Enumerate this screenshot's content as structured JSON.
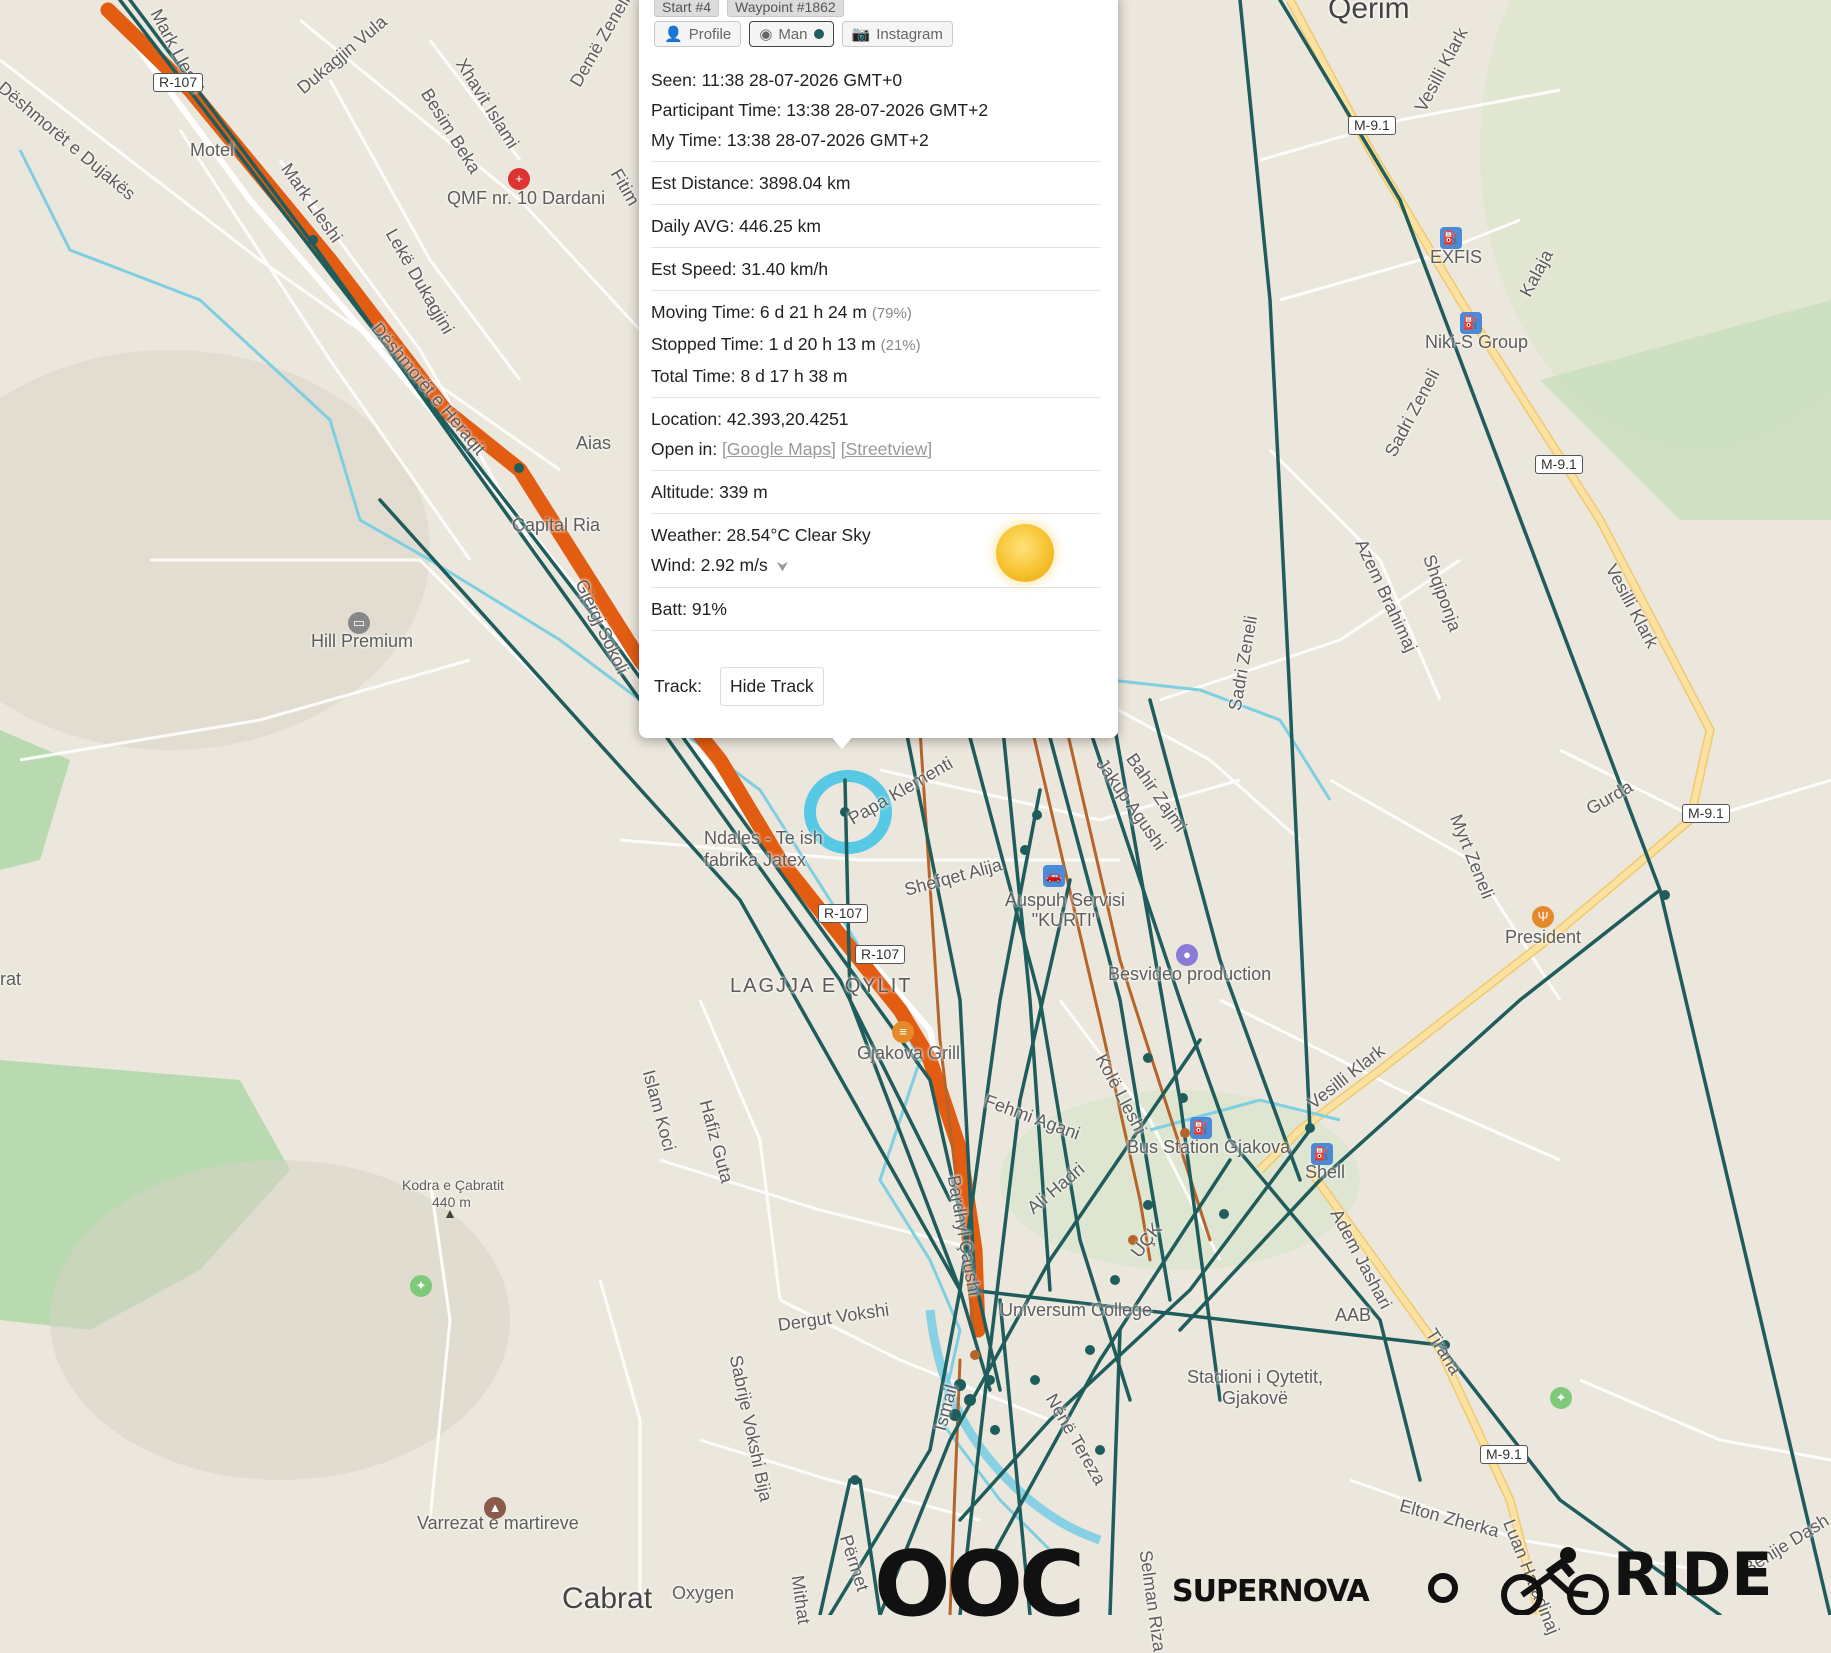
{
  "map": {
    "street_labels": [
      {
        "text": "Dëshmorët e Dujakës"
      },
      {
        "text": "Dukagjin Vula"
      },
      {
        "text": "Xhavit Islami"
      },
      {
        "text": "Besim Beka"
      },
      {
        "text": "Demë Zeneli"
      },
      {
        "text": "Mark Lleshi"
      },
      {
        "text": "Mark Lleshi"
      },
      {
        "text": "Lekë Dukagjini"
      },
      {
        "text": "Dëshmorët e Heraqit"
      },
      {
        "text": "Gjergj Sokoli"
      },
      {
        "text": "Fitim"
      },
      {
        "text": "Papa Klementi"
      },
      {
        "text": "Shefqet Alija"
      },
      {
        "text": "Islam Koci"
      },
      {
        "text": "Hafiz Guta"
      },
      {
        "text": "Fehmi Agani"
      },
      {
        "text": "Ali Hadri"
      },
      {
        "text": "Dergut Vokshi"
      },
      {
        "text": "Sabrije Vokshi Bija"
      },
      {
        "text": "Bardhyl Çaushi"
      },
      {
        "text": "Kolë Lleshi"
      },
      {
        "text": "Jakup Agushi"
      },
      {
        "text": "Bahir Zajmi"
      },
      {
        "text": "Sadri Zeneli"
      },
      {
        "text": "Sadri Zeneli"
      },
      {
        "text": "Azem Brahimaj"
      },
      {
        "text": "Shqiponja"
      },
      {
        "text": "Vesilli Klark"
      },
      {
        "text": "Vesilli Klark"
      },
      {
        "text": "Vesilli Klark"
      },
      {
        "text": "Kalaja"
      },
      {
        "text": "Myrt Zeneli"
      },
      {
        "text": "Gurda"
      },
      {
        "text": "Adem Jashari"
      },
      {
        "text": "Tirana"
      },
      {
        "text": "Elton Zherka"
      },
      {
        "text": "Luan Haradinaj"
      },
      {
        "text": "Behije Dash"
      },
      {
        "text": "Selman Riza"
      },
      {
        "text": "Përmet"
      },
      {
        "text": "Mithat"
      },
      {
        "text": "Ismail"
      },
      {
        "text": "Nënë Tereza"
      },
      {
        "text": "UÇK"
      }
    ],
    "place_labels": [
      {
        "text": "Qerim",
        "kind": "big"
      },
      {
        "text": "LAGJJA E QYLIT",
        "kind": "district"
      },
      {
        "text": "Cabrat",
        "kind": "big"
      },
      {
        "text": "Motel"
      },
      {
        "text": "QMF nr. 10 Dardani"
      },
      {
        "text": "Aias"
      },
      {
        "text": "Capital Ria"
      },
      {
        "text": "Hill Premium"
      },
      {
        "text": "Ndales - Te ish fabrika Jatex"
      },
      {
        "text": "Auspuh Servisi \"KURTI\""
      },
      {
        "text": "Besvideo production"
      },
      {
        "text": "Gjakova Grill"
      },
      {
        "text": "Bus Station Gjakova"
      },
      {
        "text": "Shell"
      },
      {
        "text": "AAB"
      },
      {
        "text": "Universum College"
      },
      {
        "text": "Stadioni i Qytetit, Gjakovë"
      },
      {
        "text": "EXFIS"
      },
      {
        "text": "Niki-S Group"
      },
      {
        "text": "President"
      },
      {
        "text": "Kodra e Çabratit"
      },
      {
        "text": "440 m"
      },
      {
        "text": "Varrezat e martireve"
      },
      {
        "text": "Oxygen"
      },
      {
        "text": "rat"
      }
    ],
    "route_shields": [
      "R-107",
      "R-107",
      "R-107",
      "M-9.1",
      "M-9.1",
      "M-9.1",
      "M-9.1"
    ],
    "colors": {
      "track_orange": "#e25c12",
      "track_teal": "#1f5c5c",
      "track_brown": "#b5652a",
      "river": "#5ac8e0",
      "road_major": "#f4d488",
      "green_area": "#b9dab0"
    }
  },
  "popup": {
    "tags": [
      "Start #4",
      "Waypoint #1862"
    ],
    "buttons": [
      {
        "label": "Profile",
        "icon": "user-plus-icon"
      },
      {
        "label": "Man",
        "icon": "user-icon",
        "active": true
      },
      {
        "label": "Instagram",
        "icon": "camera-icon"
      }
    ],
    "seen": "Seen: 11:38 28-07-2026 GMT+0",
    "participant_time": "Participant Time: 13:38 28-07-2026 GMT+2",
    "my_time": "My Time: 13:38 28-07-2026 GMT+2",
    "est_distance": "Est Distance: 3898.04 km",
    "daily_avg": "Daily AVG: 446.25 km",
    "est_speed": "Est Speed: 31.40 km/h",
    "moving_time": "Moving Time: 6 d 21 h 24 m",
    "moving_pct": "(79%)",
    "stopped_time": "Stopped Time: 1 d 20 h 13 m",
    "stopped_pct": "(21%)",
    "total_time": "Total Time: 8 d 17 h 38 m",
    "location": "Location: 42.393,20.4251",
    "open_in": "Open in:",
    "google_maps": "[Google Maps]",
    "streetview": "[Streetview]",
    "altitude": "Altitude: 339 m",
    "weather": "Weather: 28.54°C Clear Sky",
    "wind": "Wind: 2.92 m/s",
    "wind_arrow": "⮟",
    "weather_icon": "sun-icon",
    "batt": "Batt: 91%",
    "track_label": "Track:",
    "hide_track": "Hide Track"
  },
  "logos": [
    "OOC",
    "SUPERNOVA",
    "RIDE"
  ]
}
